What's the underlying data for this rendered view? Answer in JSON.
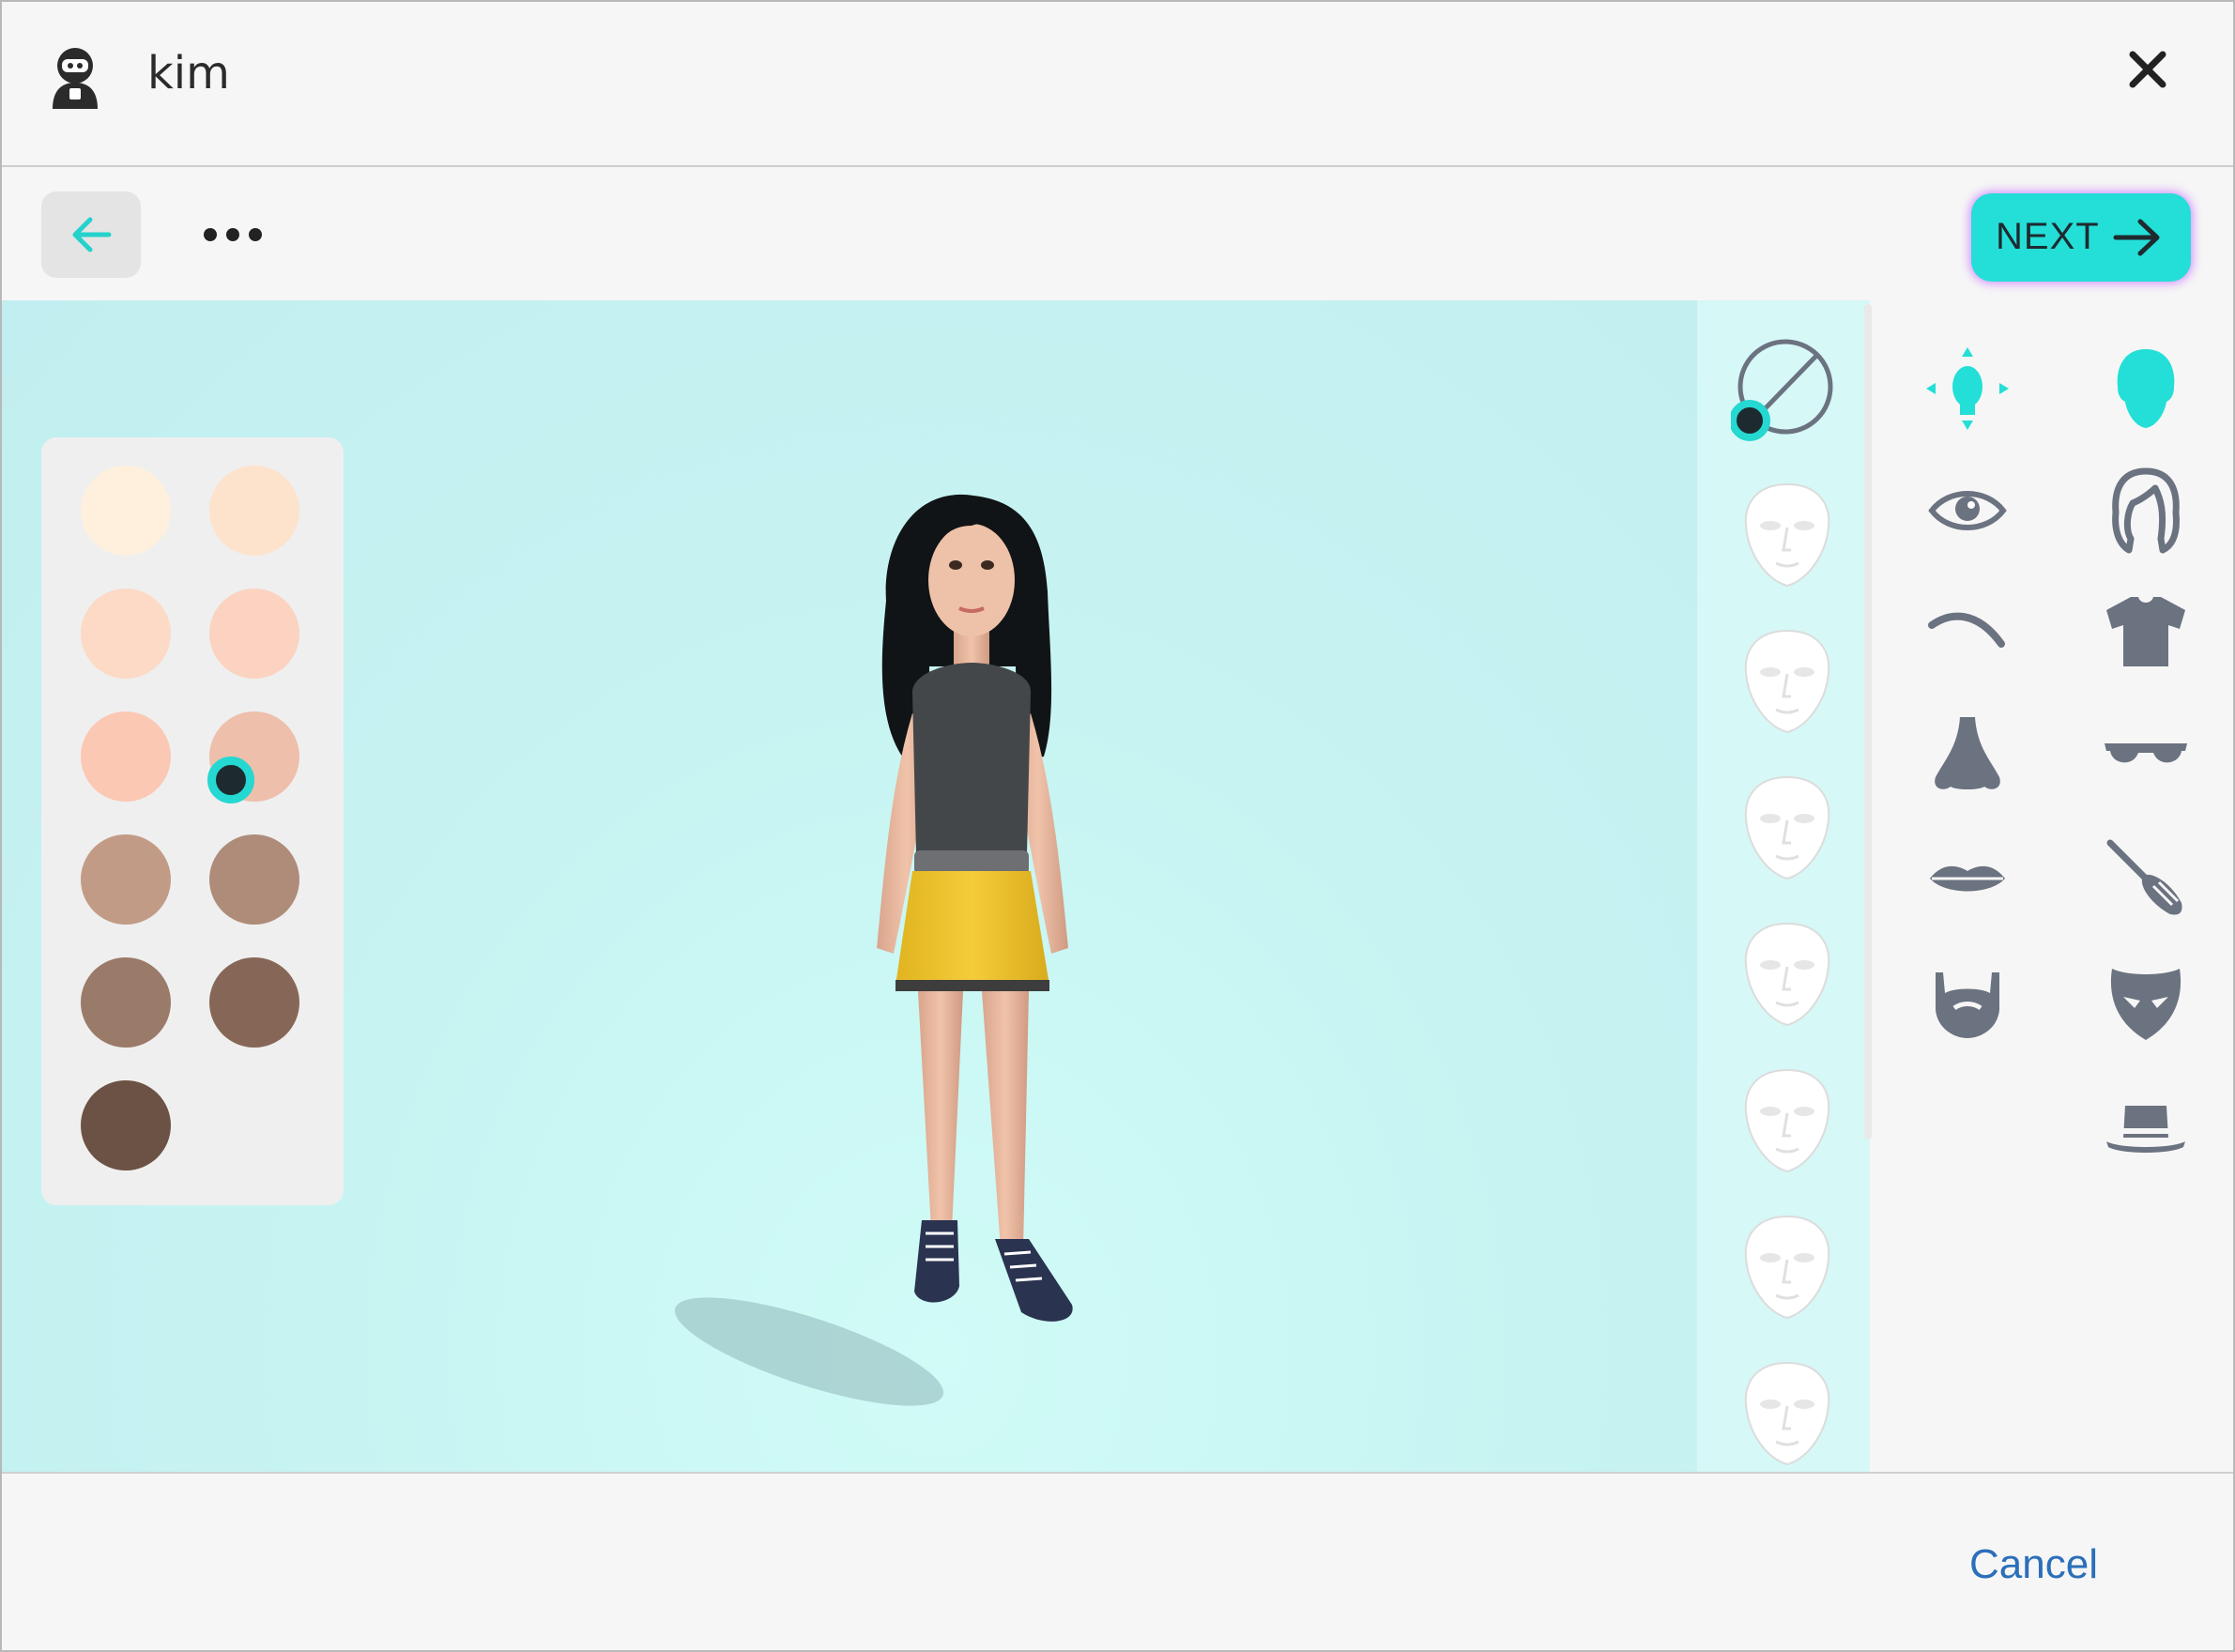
{
  "window": {
    "title": "kim"
  },
  "toolbar": {
    "next_label": "NEXT"
  },
  "skin_tones": {
    "colors": [
      "#fef0dd",
      "#fde2cc",
      "#fcdac6",
      "#fbd3c0",
      "#fbc8b4",
      "#eebfaa",
      "#c29b86",
      "#ae8c79",
      "#9a7a69",
      "#866757",
      "#6c5244"
    ],
    "selected_index": 5
  },
  "face_column": {
    "none_option": "no-selection-icon",
    "face_presets": [
      "face-preset-icon",
      "face-preset-icon",
      "face-preset-icon",
      "face-preset-icon",
      "face-preset-icon",
      "face-preset-icon",
      "face-preset-icon"
    ]
  },
  "categories": {
    "left": [
      "head-shape-icon",
      "eye-icon",
      "eyebrow-icon",
      "nose-icon",
      "lips-icon",
      "beard-icon"
    ],
    "right": [
      "head-icon",
      "hair-icon",
      "shirt-icon",
      "glasses-icon",
      "makeup-brush-icon",
      "mask-icon",
      "hat-icon"
    ],
    "active": "head-icon",
    "active_color": "#23dfd7",
    "inactive_color": "#6b7280"
  },
  "footer": {
    "cancel_label": "Cancel"
  }
}
